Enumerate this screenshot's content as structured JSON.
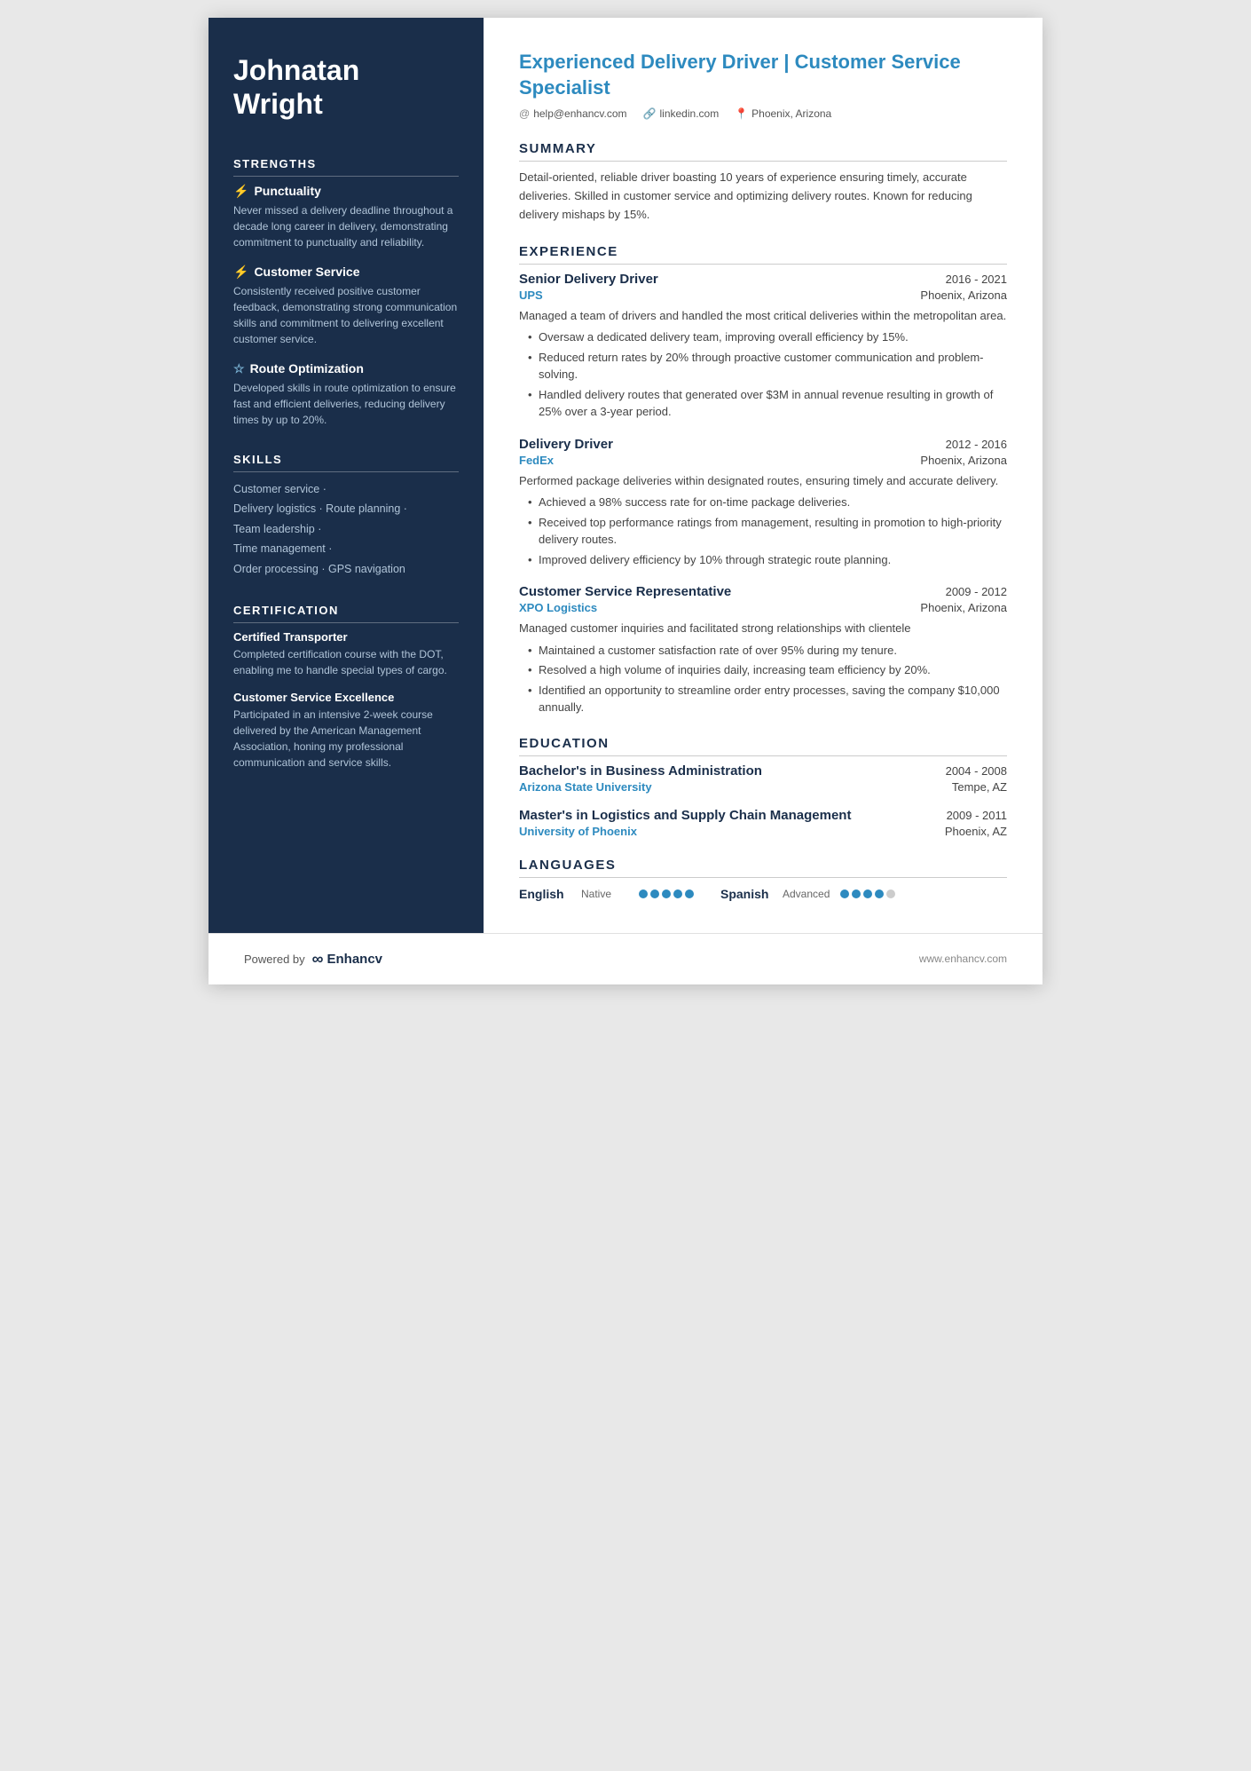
{
  "sidebar": {
    "name_line1": "Johnatan",
    "name_line2": "Wright",
    "strengths_title": "STRENGTHS",
    "strengths": [
      {
        "icon": "⚡",
        "title": "Punctuality",
        "desc": "Never missed a delivery deadline throughout a decade long career in delivery, demonstrating commitment to punctuality and reliability."
      },
      {
        "icon": "⚡",
        "title": "Customer Service",
        "desc": "Consistently received positive customer feedback, demonstrating strong communication skills and commitment to delivering excellent customer service."
      },
      {
        "icon": "☆",
        "title": "Route Optimization",
        "desc": "Developed skills in route optimization to ensure fast and efficient deliveries, reducing delivery times by up to 20%."
      }
    ],
    "skills_title": "SKILLS",
    "skills": [
      "Customer service ·",
      "Delivery logistics · Route planning ·",
      "Team leadership ·",
      "Time management ·",
      "Order processing · GPS navigation"
    ],
    "cert_title": "CERTIFICATION",
    "certs": [
      {
        "title": "Certified Transporter",
        "desc": "Completed certification course with the DOT, enabling me to handle special types of cargo."
      },
      {
        "title": "Customer Service Excellence",
        "desc": "Participated in an intensive 2-week course delivered by the American Management Association, honing my professional communication and service skills."
      }
    ]
  },
  "main": {
    "job_title": "Experienced Delivery Driver | Customer Service Specialist",
    "contact": {
      "email": "help@enhancv.com",
      "email_icon": "@",
      "linkedin": "linkedin.com",
      "linkedin_icon": "🔗",
      "location": "Phoenix, Arizona",
      "location_icon": "📍"
    },
    "summary_title": "SUMMARY",
    "summary_text": "Detail-oriented, reliable driver boasting 10 years of experience ensuring timely, accurate deliveries. Skilled in customer service and optimizing delivery routes. Known for reducing delivery mishaps by 15%.",
    "experience_title": "EXPERIENCE",
    "experience": [
      {
        "role": "Senior Delivery Driver",
        "dates": "2016 - 2021",
        "company": "UPS",
        "location": "Phoenix, Arizona",
        "desc": "Managed a team of drivers and handled the most critical deliveries within the metropolitan area.",
        "bullets": [
          "Oversaw a dedicated delivery team, improving overall efficiency by 15%.",
          "Reduced return rates by 20% through proactive customer communication and problem-solving.",
          "Handled delivery routes that generated over $3M in annual revenue resulting in growth of 25% over a 3-year period."
        ]
      },
      {
        "role": "Delivery Driver",
        "dates": "2012 - 2016",
        "company": "FedEx",
        "location": "Phoenix, Arizona",
        "desc": "Performed package deliveries within designated routes, ensuring timely and accurate delivery.",
        "bullets": [
          "Achieved a 98% success rate for on-time package deliveries.",
          "Received top performance ratings from management, resulting in promotion to high-priority delivery routes.",
          "Improved delivery efficiency by 10% through strategic route planning."
        ]
      },
      {
        "role": "Customer Service Representative",
        "dates": "2009 - 2012",
        "company": "XPO Logistics",
        "location": "Phoenix, Arizona",
        "desc": "Managed customer inquiries and facilitated strong relationships with clientele",
        "bullets": [
          "Maintained a customer satisfaction rate of over 95% during my tenure.",
          "Resolved a high volume of inquiries daily, increasing team efficiency by 20%.",
          "Identified an opportunity to streamline order entry processes, saving the company $10,000 annually."
        ]
      }
    ],
    "education_title": "EDUCATION",
    "education": [
      {
        "degree": "Bachelor's in Business Administration",
        "dates": "2004 - 2008",
        "school": "Arizona State University",
        "location": "Tempe, AZ"
      },
      {
        "degree": "Master's in Logistics and Supply Chain Management",
        "dates": "2009 - 2011",
        "school": "University of Phoenix",
        "location": "Phoenix, AZ"
      }
    ],
    "languages_title": "LANGUAGES",
    "languages": [
      {
        "name": "English",
        "level": "Native",
        "dots": 5,
        "filled": 5
      },
      {
        "name": "Spanish",
        "level": "Advanced",
        "dots": 5,
        "filled": 4
      }
    ]
  },
  "footer": {
    "powered_by": "Powered by",
    "brand": "Enhancv",
    "website": "www.enhancv.com"
  }
}
